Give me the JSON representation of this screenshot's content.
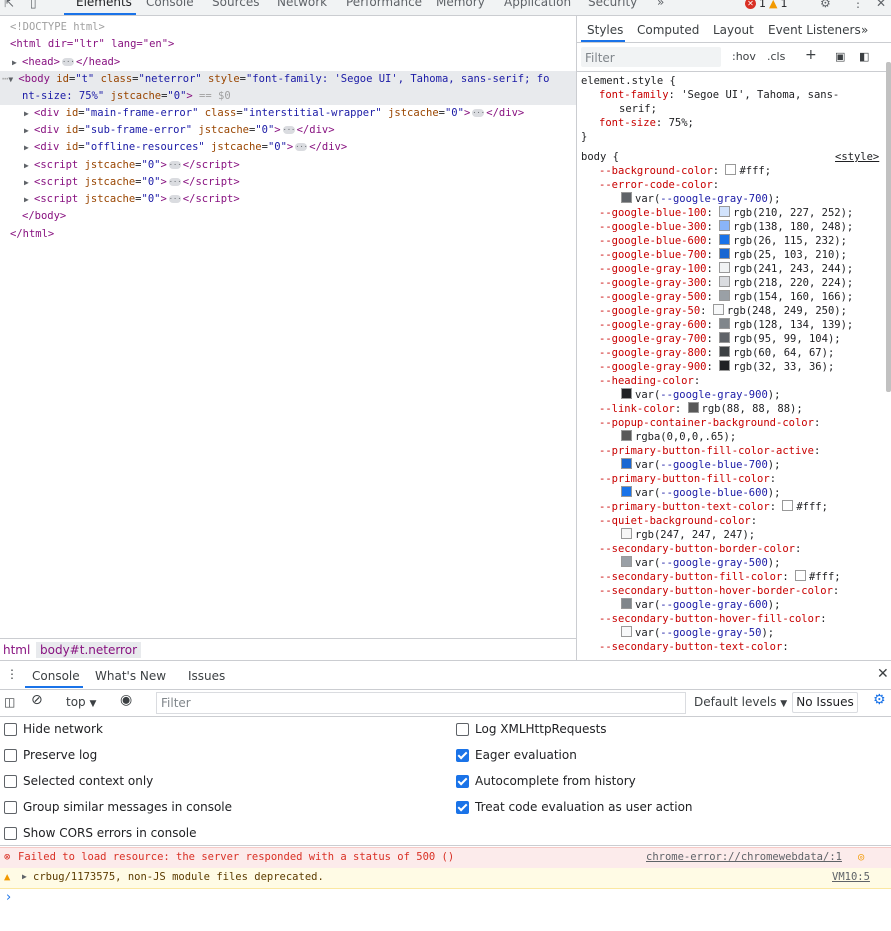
{
  "topbar": {
    "tabs": [
      "Elements",
      "Console",
      "Sources",
      "Network",
      "Performance",
      "Memory",
      "Application",
      "Security"
    ],
    "more": "»",
    "errors_count": "1",
    "warnings_count": "1"
  },
  "elements": {
    "lines": {
      "doctype": "<!DOCTYPE html>",
      "html_open": "<html dir=\"ltr\" lang=\"en\">",
      "head": "<head>",
      "head_close": "</head>",
      "body_tag": "body",
      "body_id_attr": "id",
      "body_id_val": "\"t\"",
      "body_class_attr": "class",
      "body_class_val": "\"neterror\"",
      "body_style_attr": "style",
      "body_style_val_1": "\"font-family: 'Segoe UI', Tahoma, sans-serif; fo",
      "body_style_val_2": "nt-size: 75%\"",
      "body_jst_attr": "jstcache",
      "body_jst_val": "\"0\"",
      "eq0": "== $0",
      "div1_id": "\"main-frame-error\"",
      "div1_class": "\"interstitial-wrapper\"",
      "div1_jst": "\"0\"",
      "div2_id": "\"sub-frame-error\"",
      "div2_jst": "\"0\"",
      "div3_id": "\"offline-resources\"",
      "div3_jst": "\"0\"",
      "script_jst": "\"0\"",
      "body_close": "</body>",
      "html_close": "</html>"
    },
    "breadcrumb": [
      "html",
      "body#t.neterror"
    ]
  },
  "styles": {
    "tabs": [
      "Styles",
      "Computed",
      "Layout",
      "Event Listeners",
      "»"
    ],
    "filter_placeholder": "Filter",
    "hov": ":hov",
    "cls": ".cls",
    "element_style_selector": "element.style {",
    "element_style": [
      {
        "prop": "font-family",
        "val": "'Segoe UI', Tahoma, sans-"
      },
      {
        "prop": "",
        "val": "serif;"
      },
      {
        "prop": "font-size",
        "val": "75%;"
      }
    ],
    "close_brace": "}",
    "body_selector": "body {",
    "body_source": "<style>",
    "vars": [
      {
        "prop": "--background-color",
        "swatch": "#ffffff",
        "val": "#fff;",
        "wrap": false
      },
      {
        "prop": "--error-code-color",
        "swatch": "",
        "val": "",
        "wrap": false
      },
      {
        "prop": "",
        "swatch": "#5f6368",
        "val": "var(--google-gray-700);",
        "wrap": true,
        "isvar": true
      },
      {
        "prop": "--google-blue-100",
        "swatch": "#d2e3fc",
        "val": "rgb(210, 227, 252);",
        "wrap": false
      },
      {
        "prop": "--google-blue-300",
        "swatch": "#8ab4f8",
        "val": "rgb(138, 180, 248);",
        "wrap": false
      },
      {
        "prop": "--google-blue-600",
        "swatch": "#1a73e8",
        "val": "rgb(26, 115, 232);",
        "wrap": false
      },
      {
        "prop": "--google-blue-700",
        "swatch": "#1967d2",
        "val": "rgb(25, 103, 210);",
        "wrap": false
      },
      {
        "prop": "--google-gray-100",
        "swatch": "#f1f3f4",
        "val": "rgb(241, 243, 244);",
        "wrap": false
      },
      {
        "prop": "--google-gray-300",
        "swatch": "#dadce0",
        "val": "rgb(218, 220, 224);",
        "wrap": false
      },
      {
        "prop": "--google-gray-500",
        "swatch": "#9aa0a6",
        "val": "rgb(154, 160, 166);",
        "wrap": false
      },
      {
        "prop": "--google-gray-50",
        "swatch": "#f8f9fa",
        "val": "rgb(248, 249, 250);",
        "wrap": false
      },
      {
        "prop": "--google-gray-600",
        "swatch": "#80868b",
        "val": "rgb(128, 134, 139);",
        "wrap": false
      },
      {
        "prop": "--google-gray-700",
        "swatch": "#5f6368",
        "val": "rgb(95, 99, 104);",
        "wrap": false
      },
      {
        "prop": "--google-gray-800",
        "swatch": "#3c4043",
        "val": "rgb(60, 64, 67);",
        "wrap": false
      },
      {
        "prop": "--google-gray-900",
        "swatch": "#202124",
        "val": "rgb(32, 33, 36);",
        "wrap": false
      },
      {
        "prop": "--heading-color",
        "swatch": "",
        "val": "",
        "wrap": false
      },
      {
        "prop": "",
        "swatch": "#202124",
        "val": "var(--google-gray-900);",
        "wrap": true,
        "isvar": true
      },
      {
        "prop": "--link-color",
        "swatch": "#585858",
        "val": "rgb(88, 88, 88);",
        "wrap": false
      },
      {
        "prop": "--popup-container-background-color",
        "swatch": "",
        "val": "",
        "wrap": false
      },
      {
        "prop": "",
        "swatch": "#595959",
        "val": "rgba(0,0,0,.65);",
        "wrap": true
      },
      {
        "prop": "--primary-button-fill-color-active",
        "swatch": "",
        "val": "",
        "wrap": false
      },
      {
        "prop": "",
        "swatch": "#1967d2",
        "val": "var(--google-blue-700);",
        "wrap": true,
        "isvar": true
      },
      {
        "prop": "--primary-button-fill-color",
        "swatch": "",
        "val": "",
        "wrap": false
      },
      {
        "prop": "",
        "swatch": "#1a73e8",
        "val": "var(--google-blue-600);",
        "wrap": true,
        "isvar": true
      },
      {
        "prop": "--primary-button-text-color",
        "swatch": "#ffffff",
        "val": "#fff;",
        "wrap": false
      },
      {
        "prop": "--quiet-background-color",
        "swatch": "",
        "val": "",
        "wrap": false
      },
      {
        "prop": "",
        "swatch": "#f7f7f7",
        "val": "rgb(247, 247, 247);",
        "wrap": true
      },
      {
        "prop": "--secondary-button-border-color",
        "swatch": "",
        "val": "",
        "wrap": false
      },
      {
        "prop": "",
        "swatch": "#9aa0a6",
        "val": "var(--google-gray-500);",
        "wrap": true,
        "isvar": true
      },
      {
        "prop": "--secondary-button-fill-color",
        "swatch": "#ffffff",
        "val": "#fff;",
        "wrap": false
      },
      {
        "prop": "--secondary-button-hover-border-color",
        "swatch": "",
        "val": "",
        "wrap": false
      },
      {
        "prop": "",
        "swatch": "#80868b",
        "val": "var(--google-gray-600);",
        "wrap": true,
        "isvar": true
      },
      {
        "prop": "--secondary-button-hover-fill-color",
        "swatch": "",
        "val": "",
        "wrap": false
      },
      {
        "prop": "",
        "swatch": "#f8f9fa",
        "val": "var(--google-gray-50);",
        "wrap": true,
        "isvar": true
      },
      {
        "prop": "--secondary-button-text-color",
        "swatch": "",
        "val": "",
        "wrap": false
      }
    ]
  },
  "drawer": {
    "tabs": [
      "Console",
      "What's New",
      "Issues"
    ],
    "context": "top",
    "filter_placeholder": "Filter",
    "levels": "Default levels",
    "no_issues": "No Issues",
    "settings_left": [
      {
        "label": "Hide network",
        "checked": false
      },
      {
        "label": "Preserve log",
        "checked": false
      },
      {
        "label": "Selected context only",
        "checked": false
      },
      {
        "label": "Group similar messages in console",
        "checked": false
      },
      {
        "label": "Show CORS errors in console",
        "checked": false
      }
    ],
    "settings_right": [
      {
        "label": "Log XMLHttpRequests",
        "checked": false
      },
      {
        "label": "Eager evaluation",
        "checked": true
      },
      {
        "label": "Autocomplete from history",
        "checked": true
      },
      {
        "label": "Treat code evaluation as user action",
        "checked": true
      }
    ],
    "messages": [
      {
        "level": "error",
        "text": "Failed to load resource: the server responded with a status of 500 ()",
        "source": "chrome-error://chromewebdata/:1"
      },
      {
        "level": "warning",
        "text": "crbug/1173575, non-JS module files deprecated.",
        "source": "VM10:5"
      }
    ],
    "prompt": "›"
  },
  "colors": {
    "accent": "#1a73e8",
    "error": "#d93025",
    "warning": "#f29900"
  }
}
